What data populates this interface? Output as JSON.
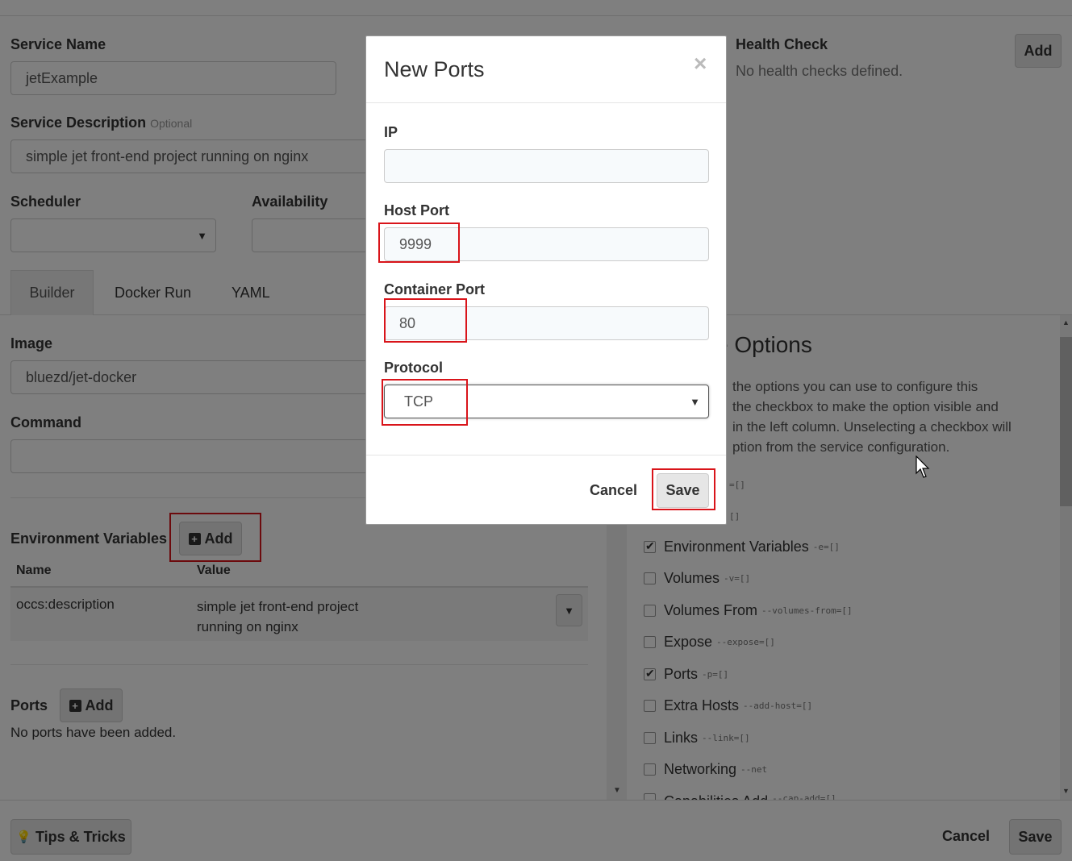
{
  "service": {
    "name_label": "Service Name",
    "name_value": "jetExample",
    "desc_label": "Service Description",
    "desc_optional": "Optional",
    "desc_value": "simple jet front-end project running on nginx",
    "scheduler_label": "Scheduler",
    "availability_label": "Availability"
  },
  "health": {
    "label": "Health Check",
    "empty": "No health checks defined.",
    "add": "Add"
  },
  "tabs": [
    {
      "label": "Builder"
    },
    {
      "label": "Docker Run"
    },
    {
      "label": "YAML"
    }
  ],
  "builder": {
    "image_label": "Image",
    "image_value": "bluezd/jet-docker",
    "command_label": "Command",
    "env_label": "Environment Variables",
    "env_add": "Add",
    "col_name": "Name",
    "col_value": "Value",
    "env_rows": [
      {
        "name": "occs:description",
        "value_line1": "simple jet front-end project",
        "value_line2": "running on nginx"
      }
    ],
    "ports_label": "Ports",
    "ports_add": "Add",
    "ports_empty": "No ports have been added."
  },
  "options": {
    "title_visible": "e Options",
    "desc_lines": [
      "the options you can use to configure this",
      "the checkbox to make the option visible and",
      "in the left column. Unselecting a checkbox will",
      "ption from the service configuration."
    ],
    "partial_codes": [
      "=[]",
      "[]"
    ],
    "items": [
      {
        "label": "Environment Variables",
        "code": "-e=[]",
        "checked": true
      },
      {
        "label": "Volumes",
        "code": "-v=[]",
        "checked": false
      },
      {
        "label": "Volumes From",
        "code": "--volumes-from=[]",
        "checked": false
      },
      {
        "label": "Expose",
        "code": "--expose=[]",
        "checked": false
      },
      {
        "label": "Ports",
        "code": "-p=[]",
        "checked": true
      },
      {
        "label": "Extra Hosts",
        "code": "--add-host=[]",
        "checked": false
      },
      {
        "label": "Links",
        "code": "--link=[]",
        "checked": false
      },
      {
        "label": "Networking",
        "code": "--net",
        "checked": false
      },
      {
        "label": "Capabilities Add",
        "code": "--cap-add=[]",
        "checked": false
      }
    ]
  },
  "footer": {
    "tips": "Tips & Tricks",
    "cancel": "Cancel",
    "save": "Save"
  },
  "modal": {
    "title": "New Ports",
    "close": "×",
    "ip_label": "IP",
    "ip_value": "",
    "host_label": "Host Port",
    "host_value": "9999",
    "container_label": "Container Port",
    "container_value": "80",
    "protocol_label": "Protocol",
    "protocol_value": "TCP",
    "cancel": "Cancel",
    "save": "Save"
  },
  "colors": {
    "highlight": "#d9141a",
    "overlay": "rgba(0,0,0,0.5)"
  }
}
